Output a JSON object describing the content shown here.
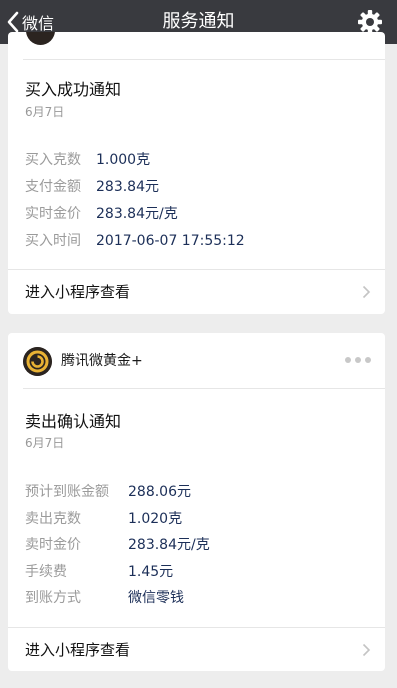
{
  "navbar": {
    "back_label": "微信",
    "title": "服务通知"
  },
  "cards": [
    {
      "title": "买入成功通知",
      "date": "6月7日",
      "rows": [
        {
          "label": "买入克数",
          "value": "1.000克"
        },
        {
          "label": "支付金额",
          "value": "283.84元"
        },
        {
          "label": "实时金价",
          "value": "283.84元/克"
        },
        {
          "label": "买入时间",
          "value": "2017-06-07 17:55:12"
        }
      ],
      "footer_label": "进入小程序查看"
    },
    {
      "brand_name": "腾讯微黄金+",
      "title": "卖出确认通知",
      "date": "6月7日",
      "rows": [
        {
          "label": "预计到账金额",
          "value": "288.06元"
        },
        {
          "label": "卖出克数",
          "value": "1.020克"
        },
        {
          "label": "卖时金价",
          "value": "283.84元/克"
        },
        {
          "label": "手续费",
          "value": "1.45元"
        },
        {
          "label": "到账方式",
          "value": "微信零钱"
        }
      ],
      "footer_label": "进入小程序查看"
    }
  ],
  "colors": {
    "navbar_bg": "#393a3f",
    "page_bg": "#ededed",
    "value_text": "#1c2f58",
    "label_text": "#9b9b9b",
    "logo_gold": "#e9b234"
  },
  "icons": {
    "back": "chevron-left-icon",
    "settings": "gear-icon",
    "more": "more-dots-icon",
    "link": "chevron-right-icon",
    "brand": "gold-coin-logo-icon"
  }
}
